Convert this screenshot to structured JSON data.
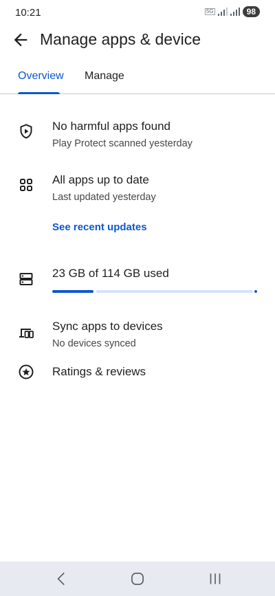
{
  "status_bar": {
    "time": "10:21",
    "network_label": "5G",
    "battery": "98"
  },
  "header": {
    "title": "Manage apps & device",
    "back_icon": "arrow-left-icon"
  },
  "tabs": [
    {
      "label": "Overview",
      "selected": true
    },
    {
      "label": "Manage",
      "selected": false
    }
  ],
  "overview": {
    "protect": {
      "icon": "shield-play-icon",
      "title": "No harmful apps found",
      "subtitle": "Play Protect scanned yesterday"
    },
    "updates": {
      "icon": "apps-grid-icon",
      "title": "All apps up to date",
      "subtitle": "Last updated yesterday",
      "link": "See recent updates"
    },
    "storage": {
      "icon": "storage-icon",
      "title": "23 GB of 114 GB used",
      "used_gb": 23,
      "total_gb": 114
    },
    "sync": {
      "icon": "devices-icon",
      "title": "Sync apps to devices",
      "subtitle": "No devices synced"
    },
    "ratings": {
      "icon": "star-circle-icon",
      "title": "Ratings & reviews"
    }
  },
  "nav_bar": {
    "buttons": [
      "back-nav-icon",
      "home-nav-icon",
      "recents-nav-icon"
    ]
  },
  "colors": {
    "accent": "#0b57d0",
    "text": "#1f1f1f",
    "subtext": "#444746",
    "nav_bg": "#e7eaf0"
  }
}
